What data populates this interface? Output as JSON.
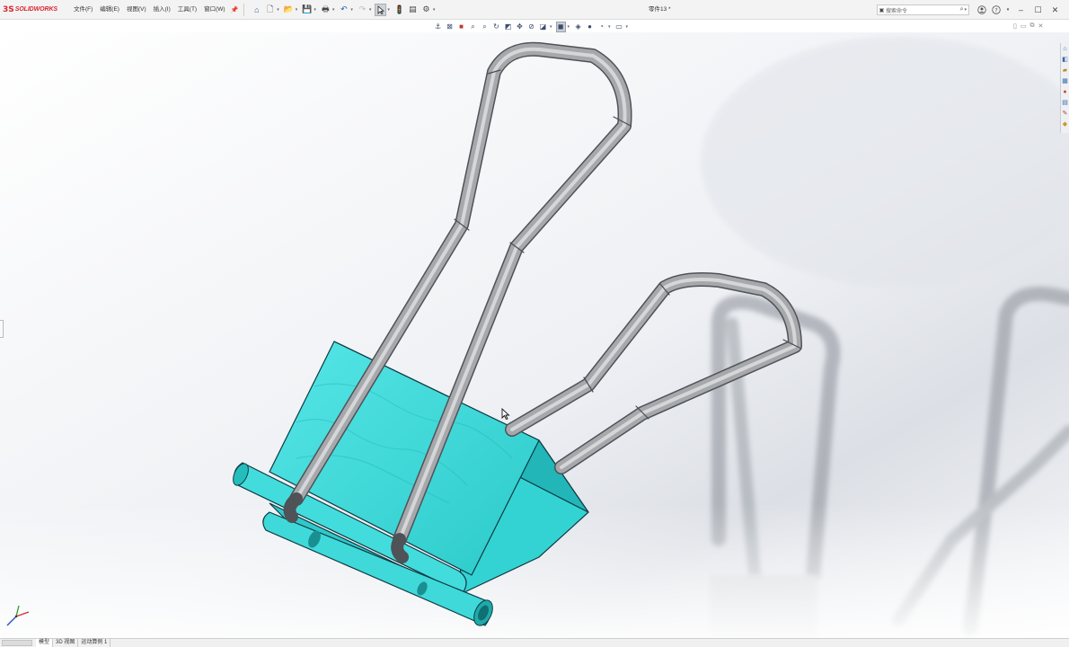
{
  "app": {
    "logo_mark": "3S",
    "logo_text": "SOLIDWORKS",
    "document_title": "零件13 *"
  },
  "menu": [
    {
      "label": "文件(F)",
      "name": "menu-file"
    },
    {
      "label": "编辑(E)",
      "name": "menu-edit"
    },
    {
      "label": "视图(V)",
      "name": "menu-view"
    },
    {
      "label": "插入(I)",
      "name": "menu-insert"
    },
    {
      "label": "工具(T)",
      "name": "menu-tools"
    },
    {
      "label": "窗口(W)",
      "name": "menu-window"
    }
  ],
  "search": {
    "placeholder": "搜索命令"
  },
  "toolbar_icons": [
    "pin-icon",
    "home-icon",
    "new-document-icon",
    "open-icon",
    "save-icon",
    "print-icon",
    "undo-icon",
    "redo-icon",
    "select-icon",
    "traffic-light-icon",
    "file-properties-icon",
    "options-icon"
  ],
  "view_toolbar_icons": [
    "zoom-to-fit-icon",
    "zoom-to-area-icon",
    "previous-view-icon",
    "section-view-icon",
    "dynamic-annotation-icon",
    "view-orientation-icon",
    "display-style-icon",
    "hide-show-items-icon",
    "edit-appearance-icon",
    "apply-scene-icon",
    "view-settings-icon"
  ],
  "taskpane_icons": [
    "resources-icon",
    "design-library-icon",
    "file-explorer-icon",
    "view-palette-icon",
    "appearances-icon",
    "custom-properties-icon",
    "forum-icon",
    "solidworks-forum-icon"
  ],
  "bottom_tabs": [
    {
      "label": "模型",
      "active": true
    },
    {
      "label": "3D 视图",
      "active": false
    },
    {
      "label": "运动算例 1",
      "active": false
    }
  ],
  "colors": {
    "brand": "#d8262d",
    "clip_body": "#3fd9d9",
    "clip_edge": "#0e3b44",
    "wire_metal": "#9c9c9c"
  }
}
